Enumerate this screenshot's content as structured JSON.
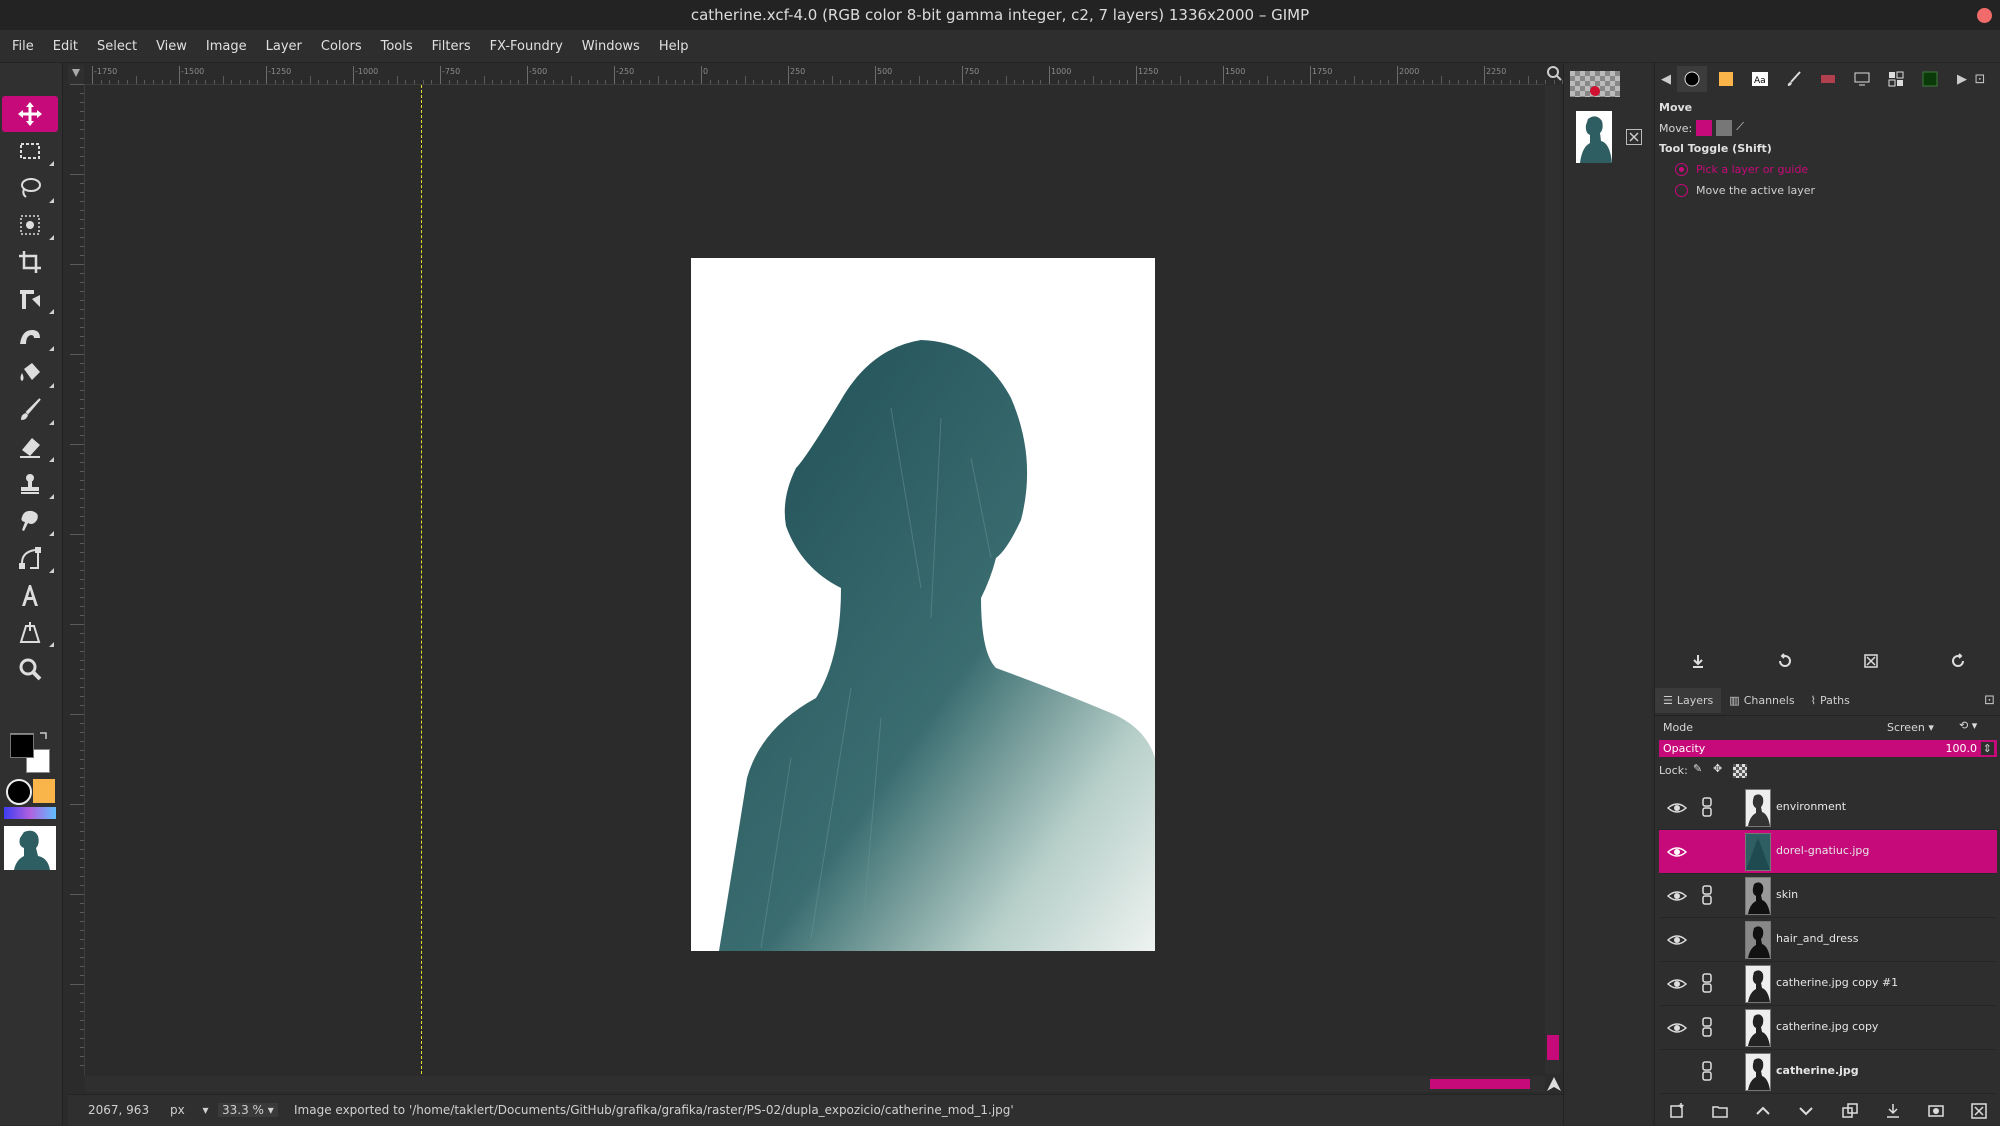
{
  "window": {
    "title": "catherine.xcf-4.0 (RGB color 8-bit gamma integer, c2, 7 layers) 1336x2000 – GIMP"
  },
  "menubar": {
    "items": [
      "File",
      "Edit",
      "Select",
      "View",
      "Image",
      "Layer",
      "Colors",
      "Tools",
      "Filters",
      "FX-Foundry",
      "Windows",
      "Help"
    ]
  },
  "toolbox": {
    "tools": [
      {
        "name": "move-tool",
        "icon": "move-icon",
        "active": true
      },
      {
        "name": "rect-select-tool",
        "icon": "rect-select-icon"
      },
      {
        "name": "free-select-tool",
        "icon": "lasso-icon"
      },
      {
        "name": "fuzzy-select-tool",
        "icon": "fuzzy-select-icon"
      },
      {
        "name": "crop-tool",
        "icon": "crop-icon"
      },
      {
        "name": "transform-tool",
        "icon": "unified-transform-icon"
      },
      {
        "name": "warp-tool",
        "icon": "warp-icon"
      },
      {
        "name": "bucket-fill-tool",
        "icon": "bucket-fill-icon"
      },
      {
        "name": "paintbrush-tool",
        "icon": "paintbrush-icon"
      },
      {
        "name": "eraser-tool",
        "icon": "eraser-icon"
      },
      {
        "name": "clone-tool",
        "icon": "clone-stamp-icon"
      },
      {
        "name": "smudge-tool",
        "icon": "smudge-icon"
      },
      {
        "name": "paths-tool",
        "icon": "paths-icon"
      },
      {
        "name": "text-tool",
        "icon": "text-icon"
      },
      {
        "name": "color-picker-tool",
        "icon": "color-picker-icon"
      },
      {
        "name": "zoom-tool",
        "icon": "zoom-icon"
      }
    ],
    "foreground_color": "#000000",
    "background_color": "#ffffff",
    "accent_color": "#c70a7a"
  },
  "rulers": {
    "top_labels": [
      "-1750",
      "-1500",
      "-1250",
      "-1000",
      "-750",
      "-500",
      "-250",
      "0",
      "250",
      "500",
      "750",
      "1000",
      "1250",
      "1500",
      "1750",
      "2000",
      "2250"
    ]
  },
  "statusbar": {
    "coords": "2067, 963",
    "unit": "px",
    "zoom": "33.3 %",
    "message": "Image exported to '/home/taklert/Documents/GitHub/grafika/grafika/raster/PS-02/dupla_expozicio/catherine_mod_1.jpg'"
  },
  "tool_options": {
    "tool_name": "Move",
    "move_label": "Move:",
    "toggle_label": "Tool Toggle  (Shift)",
    "options": [
      {
        "label": "Pick a layer or guide",
        "selected": true
      },
      {
        "label": "Move the active layer",
        "selected": false
      }
    ]
  },
  "layers_panel": {
    "tabs": [
      "Layers",
      "Channels",
      "Paths"
    ],
    "mode_label": "Mode",
    "mode_value": "Screen",
    "opacity_label": "Opacity",
    "opacity_value": "100.0",
    "lock_label": "Lock:",
    "layers": [
      {
        "name": "environment",
        "visible": true,
        "linked": true,
        "selected": false,
        "bold": false
      },
      {
        "name": "dorel-gnatiuc.jpg",
        "visible": true,
        "linked": false,
        "selected": true,
        "bold": false
      },
      {
        "name": "skin",
        "visible": true,
        "linked": true,
        "selected": false,
        "bold": false
      },
      {
        "name": "hair_and_dress",
        "visible": true,
        "linked": false,
        "selected": false,
        "bold": false
      },
      {
        "name": "catherine.jpg copy #1",
        "visible": true,
        "linked": true,
        "selected": false,
        "bold": false
      },
      {
        "name": "catherine.jpg copy",
        "visible": true,
        "linked": true,
        "selected": false,
        "bold": false
      },
      {
        "name": "catherine.jpg",
        "visible": false,
        "linked": true,
        "selected": false,
        "bold": true
      }
    ]
  }
}
